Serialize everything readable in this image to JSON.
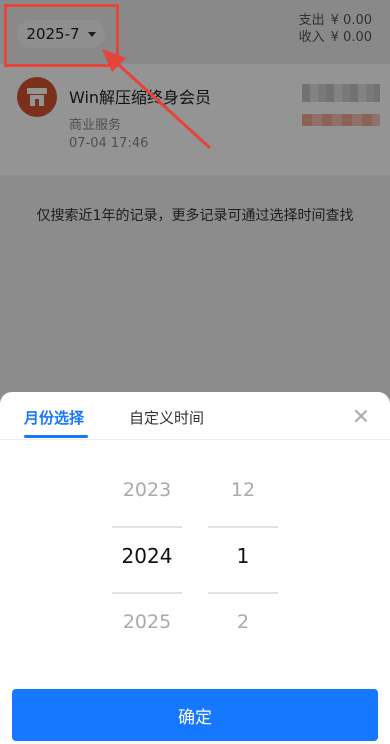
{
  "header": {
    "month_selector": "2025-7",
    "expense_label": "支出",
    "expense_value": "¥ 0.00",
    "income_label": "收入",
    "income_value": "¥ 0.00"
  },
  "transaction": {
    "title": "Win解压缩终身会员",
    "category": "商业服务",
    "time": "07-04 17:46",
    "icon": "shop-icon"
  },
  "search_note": "仅搜索近1年的记录，更多记录可通过选择时间查找",
  "sheet": {
    "tab_month": "月份选择",
    "tab_custom": "自定义时间",
    "years": [
      "2023",
      "2024",
      "2025"
    ],
    "months": [
      "12",
      "1",
      "2"
    ],
    "selected_year": "2024",
    "selected_month": "1",
    "confirm_label": "确定"
  },
  "colors": {
    "accent": "#1677ff",
    "annotation": "#e6433a",
    "merchant_icon_bg": "#d4532f"
  }
}
